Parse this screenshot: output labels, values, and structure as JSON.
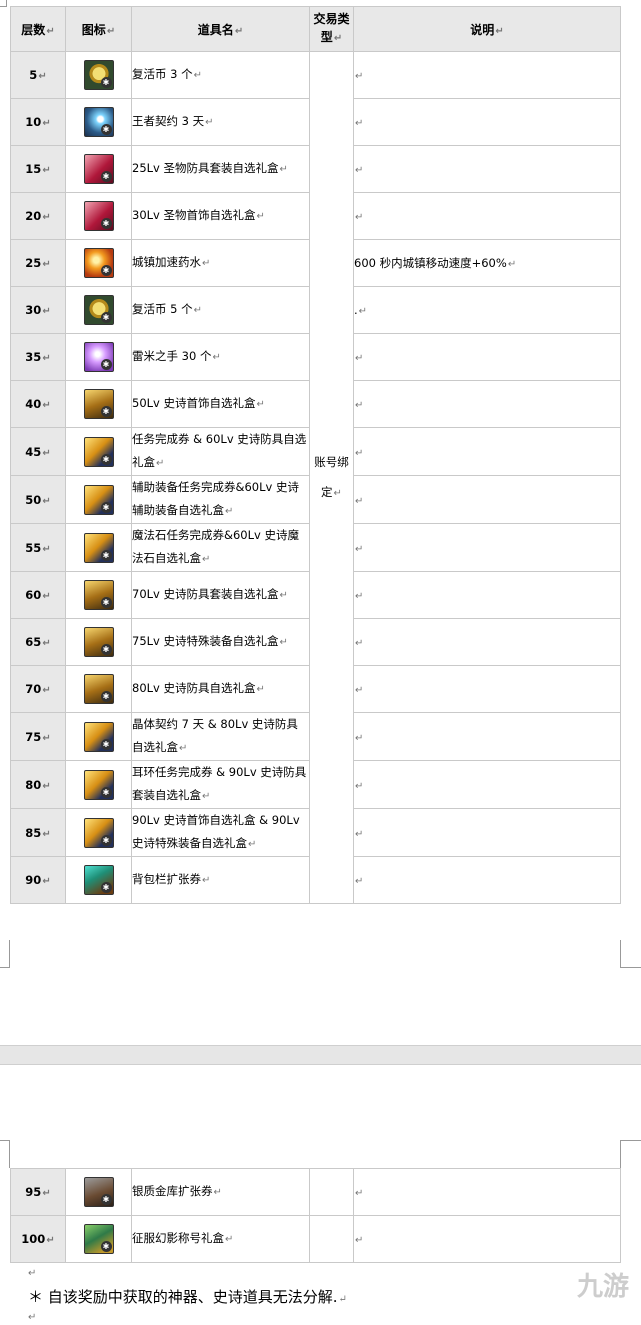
{
  "table": {
    "headers": {
      "floor": "层数",
      "icon": "图标",
      "name": "道具名",
      "trade": "交易类型",
      "note": "说明"
    },
    "trade_value": "账号绑定",
    "rows": [
      {
        "floor": "5",
        "icon": "coin-icon",
        "name": "复活币 3 个",
        "note": ""
      },
      {
        "floor": "10",
        "icon": "contract-icon",
        "name": "王者契约 3 天",
        "note": ""
      },
      {
        "floor": "15",
        "icon": "armor-box-icon",
        "name": "25Lv 圣物防具套装自选礼盒",
        "note": ""
      },
      {
        "floor": "20",
        "icon": "armor-box-icon",
        "name": "30Lv 圣物首饰自选礼盒",
        "note": ""
      },
      {
        "floor": "25",
        "icon": "potion-icon",
        "name": "城镇加速药水",
        "note": "600 秒内城镇移动速度+60%"
      },
      {
        "floor": "30",
        "icon": "coin-icon",
        "name": "复活币 5 个",
        "note": "."
      },
      {
        "floor": "35",
        "icon": "hand-icon",
        "name": "雷米之手 30 个",
        "note": ""
      },
      {
        "floor": "40",
        "icon": "chest-icon",
        "name": "50Lv 史诗首饰自选礼盒",
        "note": ""
      },
      {
        "floor": "45",
        "icon": "ticket-icon",
        "name": "任务完成券 & 60Lv 史诗防具自选礼盒",
        "note": ""
      },
      {
        "floor": "50",
        "icon": "ticket-icon",
        "name": "辅助装备任务完成券&60Lv 史诗辅助装备自选礼盒",
        "note": ""
      },
      {
        "floor": "55",
        "icon": "ticket-icon",
        "name": "魔法石任务完成券&60Lv 史诗魔法石自选礼盒",
        "note": ""
      },
      {
        "floor": "60",
        "icon": "chest-icon",
        "name": "70Lv 史诗防具套装自选礼盒",
        "note": ""
      },
      {
        "floor": "65",
        "icon": "chest-icon",
        "name": "75Lv 史诗特殊装备自选礼盒",
        "note": ""
      },
      {
        "floor": "70",
        "icon": "chest-icon",
        "name": "80Lv 史诗防具自选礼盒",
        "note": ""
      },
      {
        "floor": "75",
        "icon": "ticket-icon",
        "name": "晶体契约 7 天 & 80Lv 史诗防具自选礼盒",
        "note": ""
      },
      {
        "floor": "80",
        "icon": "ticket-icon",
        "name": "耳环任务完成券 & 90Lv 史诗防具套装自选礼盒",
        "note": ""
      },
      {
        "floor": "85",
        "icon": "ticket-icon",
        "name": "90Lv 史诗首饰自选礼盒 & 90Lv 史诗特殊装备自选礼盒",
        "note": ""
      },
      {
        "floor": "90",
        "icon": "bag-icon",
        "name": "背包栏扩张券",
        "note": ""
      }
    ],
    "rows_page2": [
      {
        "floor": "95",
        "icon": "vault-icon",
        "name": "银质金库扩张券",
        "note": ""
      },
      {
        "floor": "100",
        "icon": "title-box-icon",
        "name": "征服幻影称号礼盒",
        "note": ""
      }
    ]
  },
  "footnote": "＊ 自该奖励中获取的神器、史诗道具无法分解.",
  "watermark": "九游"
}
